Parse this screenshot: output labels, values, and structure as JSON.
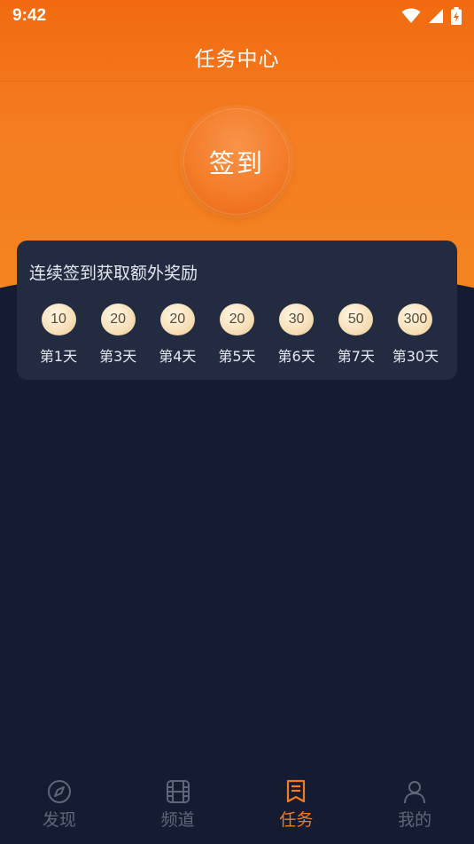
{
  "status_bar": {
    "time": "9:42"
  },
  "header": {
    "title": "任务中心"
  },
  "checkin": {
    "label": "签到"
  },
  "rewards": {
    "title": "连续签到获取额外奖励",
    "items": [
      {
        "amount": "10",
        "day": "第1天"
      },
      {
        "amount": "20",
        "day": "第3天"
      },
      {
        "amount": "20",
        "day": "第4天"
      },
      {
        "amount": "20",
        "day": "第5天"
      },
      {
        "amount": "30",
        "day": "第6天"
      },
      {
        "amount": "50",
        "day": "第7天"
      },
      {
        "amount": "300",
        "day": "第30天"
      }
    ]
  },
  "tabs": [
    {
      "label": "发现",
      "icon": "compass-icon",
      "active": false
    },
    {
      "label": "频道",
      "icon": "film-icon",
      "active": false
    },
    {
      "label": "任务",
      "icon": "task-icon",
      "active": true
    },
    {
      "label": "我的",
      "icon": "user-icon",
      "active": false
    }
  ],
  "colors": {
    "accent": "#f47a1f",
    "background": "#151c31",
    "card": "#222b40",
    "inactive": "#5e6679"
  }
}
